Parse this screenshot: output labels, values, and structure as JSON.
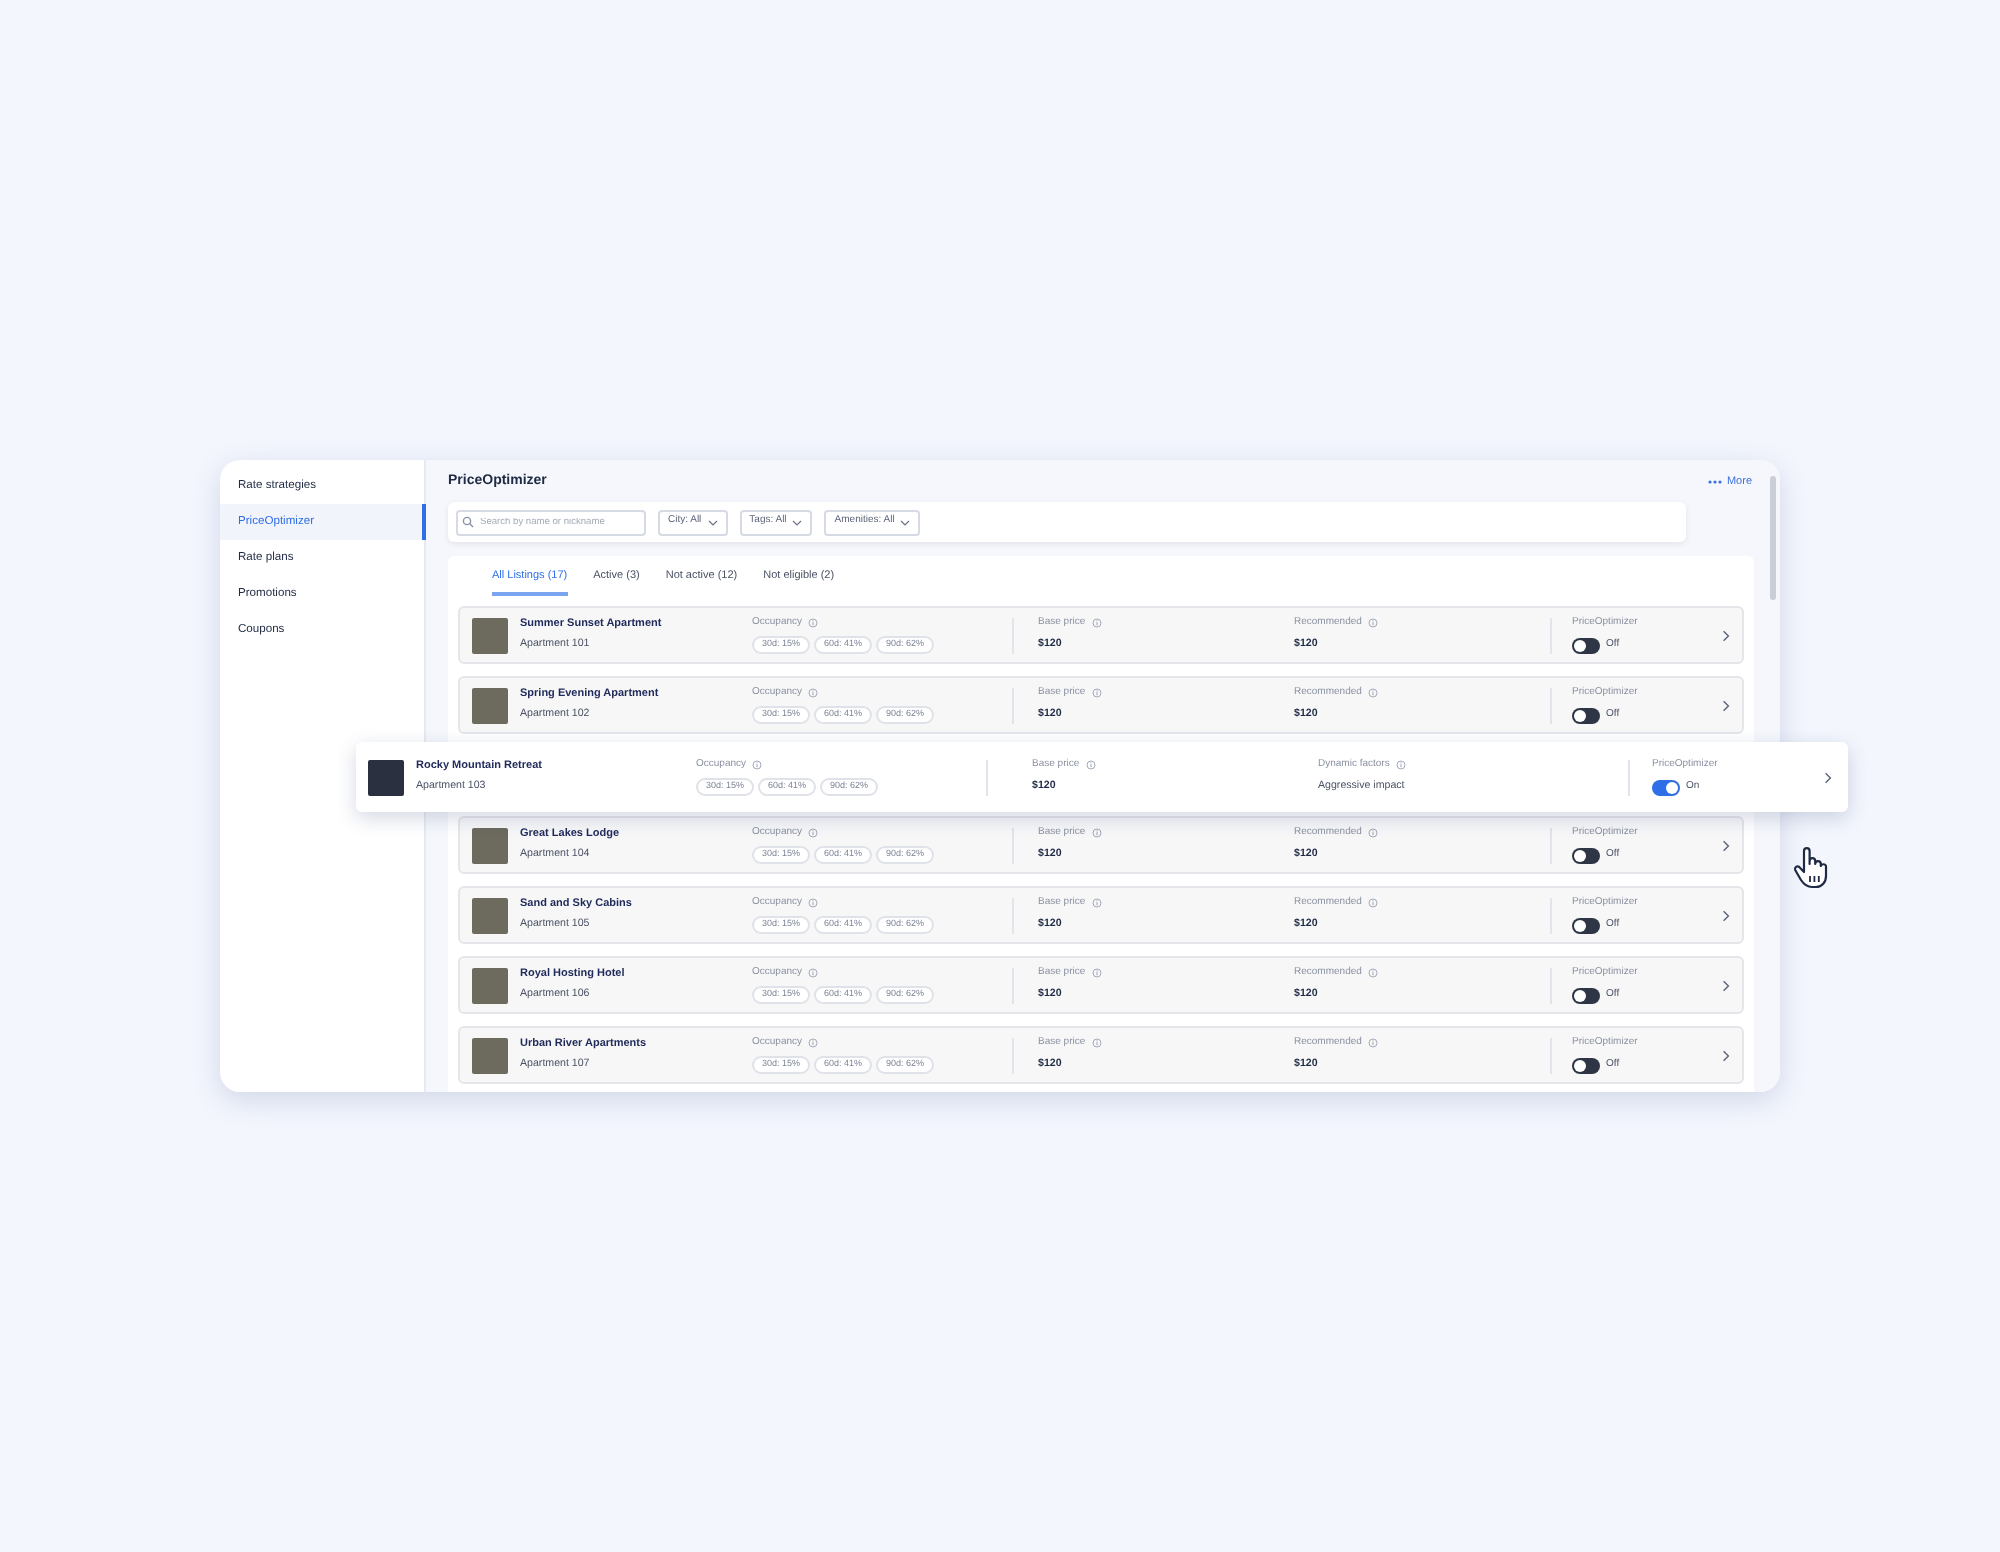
{
  "sidebar": {
    "items": [
      {
        "label": "Rate strategies",
        "selected": false
      },
      {
        "label": "PriceOptimizer",
        "selected": true
      },
      {
        "label": "Rate plans",
        "selected": false
      },
      {
        "label": "Promotions",
        "selected": false
      },
      {
        "label": "Coupons",
        "selected": false
      }
    ]
  },
  "header": {
    "title": "PriceOptimizer",
    "more": "More"
  },
  "filters": {
    "search": {
      "placeholder": "Search by name or nickname"
    },
    "dropdowns": [
      "City: All",
      "Tags: All",
      "Amenities: All"
    ]
  },
  "tabs": [
    {
      "label": "All Listings (17)",
      "selected": true
    },
    {
      "label": "Active (3)",
      "selected": false
    },
    {
      "label": "Not active (12)",
      "selected": false
    },
    {
      "label": "Not eligible (2)",
      "selected": false
    }
  ],
  "listings": [
    {
      "kind": "normal",
      "name": "Summer Sunset Apartment",
      "unit": "Apartment 101",
      "occupancy_label": "Occupancy",
      "chips": [
        "30d: 15%",
        "60d: 41%",
        "90d: 62%"
      ],
      "base_label": "Base price",
      "base_value": "$120",
      "third_label": "Recommended",
      "third_value": "$120",
      "toggle_label": "PriceOptimizer",
      "on": false,
      "state_text": "Off"
    },
    {
      "kind": "normal",
      "name": "Spring Evening Apartment",
      "unit": "Apartment 102",
      "occupancy_label": "Occupancy",
      "chips": [
        "30d: 15%",
        "60d: 41%",
        "90d: 62%"
      ],
      "base_label": "Base price",
      "base_value": "$120",
      "third_label": "Recommended",
      "third_value": "$120",
      "toggle_label": "PriceOptimizer",
      "on": false,
      "state_text": "Off"
    },
    {
      "kind": "lifted",
      "name": "Rocky Mountain Retreat",
      "unit": "Apartment 103",
      "occupancy_label": "Occupancy",
      "chips": [
        "30d: 15%",
        "60d: 41%",
        "90d: 62%"
      ],
      "base_label": "Base price",
      "base_value": "$120",
      "third_label": "Dynamic factors",
      "third_value": "Aggressive impact",
      "toggle_label": "PriceOptimizer",
      "on": true,
      "state_text": "On"
    },
    {
      "kind": "normal",
      "name": "Great Lakes Lodge",
      "unit": "Apartment 104",
      "occupancy_label": "Occupancy",
      "chips": [
        "30d: 15%",
        "60d: 41%",
        "90d: 62%"
      ],
      "base_label": "Base price",
      "base_value": "$120",
      "third_label": "Recommended",
      "third_value": "$120",
      "toggle_label": "PriceOptimizer",
      "on": false,
      "state_text": "Off"
    },
    {
      "kind": "normal",
      "name": "Sand and Sky Cabins",
      "unit": "Apartment 105",
      "occupancy_label": "Occupancy",
      "chips": [
        "30d: 15%",
        "60d: 41%",
        "90d: 62%"
      ],
      "base_label": "Base price",
      "base_value": "$120",
      "third_label": "Recommended",
      "third_value": "$120",
      "toggle_label": "PriceOptimizer",
      "on": false,
      "state_text": "Off"
    },
    {
      "kind": "normal",
      "name": "Royal Hosting Hotel",
      "unit": "Apartment 106",
      "occupancy_label": "Occupancy",
      "chips": [
        "30d: 15%",
        "60d: 41%",
        "90d: 62%"
      ],
      "base_label": "Base price",
      "base_value": "$120",
      "third_label": "Recommended",
      "third_value": "$120",
      "toggle_label": "PriceOptimizer",
      "on": false,
      "state_text": "Off"
    },
    {
      "kind": "normal",
      "name": "Urban River Apartments",
      "unit": "Apartment 107",
      "occupancy_label": "Occupancy",
      "chips": [
        "30d: 15%",
        "60d: 41%",
        "90d: 62%"
      ],
      "base_label": "Base price",
      "base_value": "$120",
      "third_label": "Recommended",
      "third_value": "$120",
      "toggle_label": "PriceOptimizer",
      "on": false,
      "state_text": "Off"
    }
  ]
}
